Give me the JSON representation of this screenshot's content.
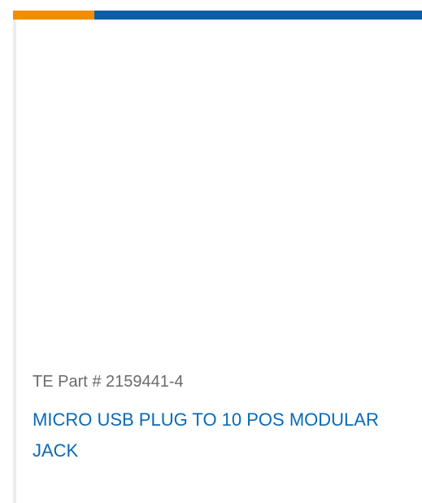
{
  "colors": {
    "accent_orange": "#f28c00",
    "accent_blue": "#0a5ea8",
    "part_number_text": "#6b6b6b",
    "title_link": "#0a6ab5",
    "card_border": "#ececec"
  },
  "product": {
    "part_number_label": "TE Part # 2159441-4",
    "title": "MICRO USB PLUG TO 10 POS MODULAR JACK"
  }
}
